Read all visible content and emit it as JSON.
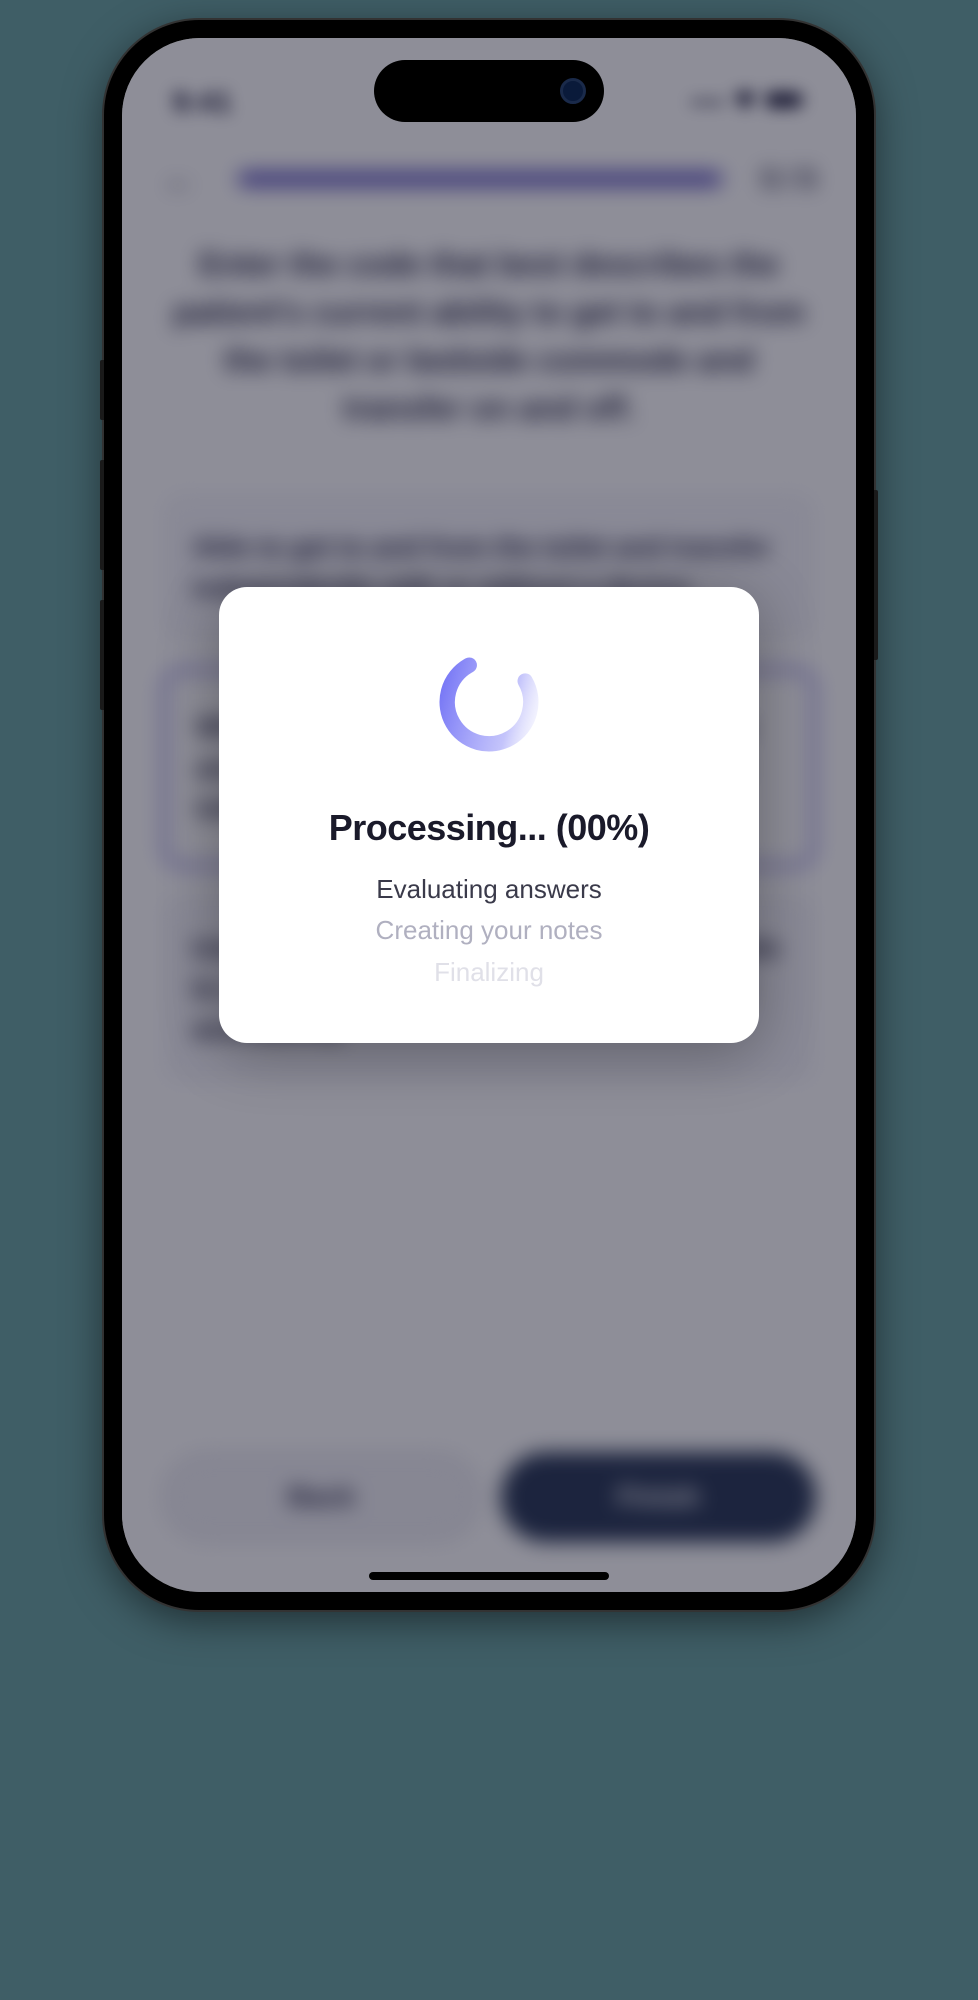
{
  "status_bar": {
    "time": "9:41",
    "signal": "•••",
    "wifi": "▲",
    "battery": "■"
  },
  "header": {
    "back_icon": "←",
    "progress_label": "5 / 5"
  },
  "question": "Enter the code that best describes the patient's current ability to get to and from the toilet or bedside commode and transfer on and off.",
  "options": [
    {
      "text": "Able to get to and from the toilet and transfer independently with or without a device.",
      "selected": false
    },
    {
      "text": "When reminded, assisted, or supervised by another person, able to get to and from the toilet and transfer.",
      "selected": true
    },
    {
      "text": "Unable to get to and from the toilet but is able to use a bedside commode (with or without assistance).",
      "selected": false
    }
  ],
  "buttons": {
    "back": "Back",
    "finish": "Finish"
  },
  "modal": {
    "title": "Processing... (00%)",
    "steps": [
      {
        "text": "Evaluating answers",
        "state": "active"
      },
      {
        "text": "Creating your notes",
        "state": "pending"
      },
      {
        "text": "Finalizing",
        "state": "faint"
      }
    ]
  },
  "colors": {
    "accent": "#6a5fd8",
    "spinner": "#6c6cf5",
    "dark_button": "#1a2a4a"
  }
}
